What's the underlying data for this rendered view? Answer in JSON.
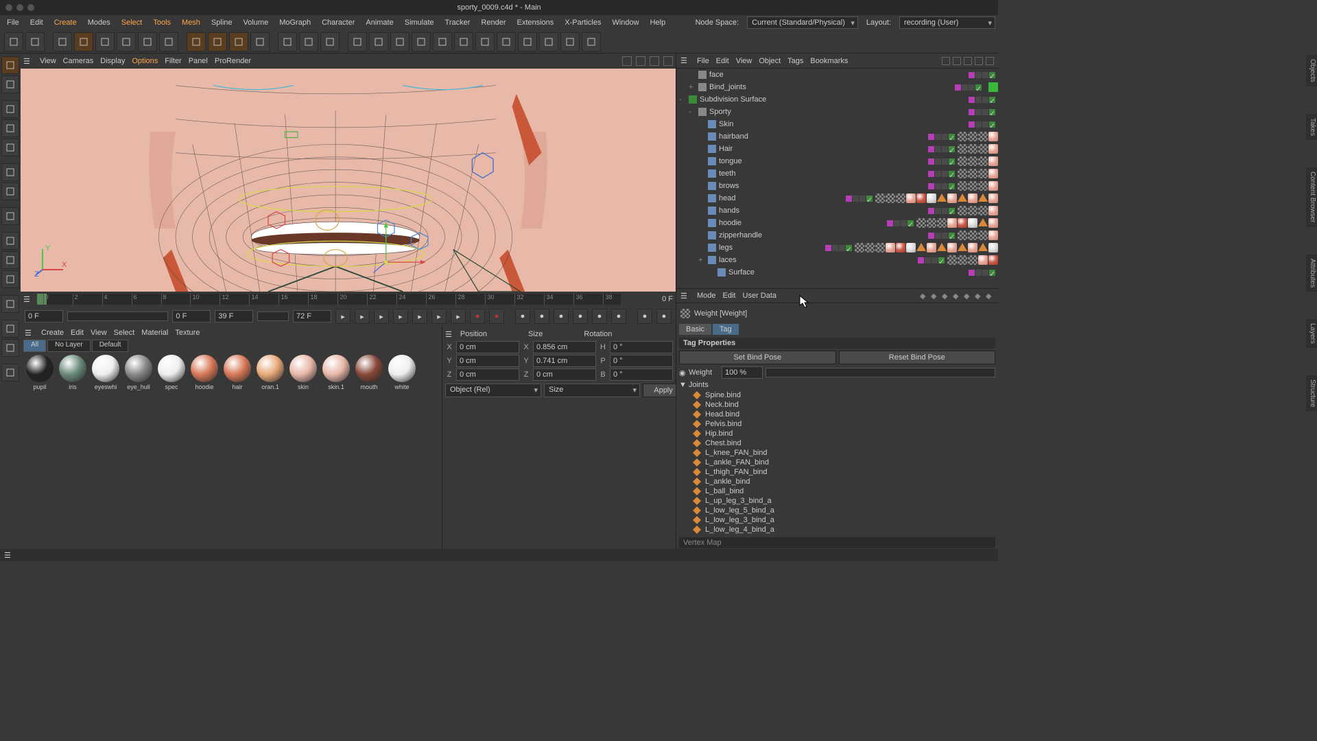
{
  "title": "sporty_0009.c4d * - Main",
  "menubar": [
    "File",
    "Edit",
    "Create",
    "Modes",
    "Select",
    "Tools",
    "Mesh",
    "Spline",
    "Volume",
    "MoGraph",
    "Character",
    "Animate",
    "Simulate",
    "Tracker",
    "Render",
    "Extensions",
    "X-Particles",
    "Window",
    "Help"
  ],
  "menubar_hl": [
    "Create",
    "Select",
    "Tools",
    "Mesh"
  ],
  "nodespace_lbl": "Node Space:",
  "nodespace_val": "Current (Standard/Physical)",
  "layout_lbl": "Layout:",
  "layout_val": "recording (User)",
  "vp_menu": [
    "View",
    "Cameras",
    "Display",
    "Options",
    "Filter",
    "Panel",
    "ProRender"
  ],
  "vp_menu_hl": [
    "Options"
  ],
  "timeline": {
    "ticks": [
      0,
      2,
      4,
      6,
      8,
      10,
      12,
      14,
      16,
      18,
      20,
      22,
      24,
      26,
      28,
      30,
      32,
      34,
      36,
      38
    ],
    "end": "0 F",
    "f0": "0 F",
    "f1": "0 F",
    "f2": "39 F",
    "f3": "72 F"
  },
  "mat_menu": [
    "Create",
    "Edit",
    "View",
    "Select",
    "Material",
    "Texture"
  ],
  "mat_tabs": [
    "All",
    "No Layer",
    "Default"
  ],
  "materials": [
    {
      "n": "pupil",
      "c": "#222"
    },
    {
      "n": "iris",
      "c": "#6a8a7a"
    },
    {
      "n": "eyeswhi",
      "c": "#eee"
    },
    {
      "n": "eye_hull",
      "c": "#888"
    },
    {
      "n": "spec",
      "c": "#eee"
    },
    {
      "n": "hoodie",
      "c": "#d87858"
    },
    {
      "n": "hair",
      "c": "#d87858"
    },
    {
      "n": "oran.1",
      "c": "#e8a878"
    },
    {
      "n": "skin",
      "c": "#e8b8a8"
    },
    {
      "n": "skin.1",
      "c": "#e8b8a8"
    },
    {
      "n": "mouth",
      "c": "#884838"
    },
    {
      "n": "white",
      "c": "#eee"
    }
  ],
  "coord": {
    "pos": "Position",
    "size": "Size",
    "rot": "Rotation",
    "px": "0 cm",
    "py": "0 cm",
    "pz": "0 cm",
    "sx": "0.856 cm",
    "sy": "0.741 cm",
    "sz": "0 cm",
    "rh": "0 °",
    "rp": "0 °",
    "rb": "0 °",
    "mode": "Object (Rel)",
    "smode": "Size",
    "apply": "Apply"
  },
  "om_menu": [
    "File",
    "Edit",
    "View",
    "Object",
    "Tags",
    "Bookmarks"
  ],
  "om_tree": [
    {
      "d": 1,
      "exp": "",
      "n": "face",
      "ico": "#888",
      "tags": 0
    },
    {
      "d": 1,
      "exp": "+",
      "n": "Bind_joints",
      "ico": "#888",
      "extra": "green"
    },
    {
      "d": 0,
      "exp": "-",
      "n": "Subdivision Surface",
      "ico": "#3a8a3a"
    },
    {
      "d": 1,
      "exp": "-",
      "n": "Sporty",
      "ico": "#888"
    },
    {
      "d": 2,
      "exp": "",
      "n": "Skin",
      "ico": "#6a8ab8"
    },
    {
      "d": 2,
      "exp": "",
      "n": "hairband",
      "ico": "#6a8ab8",
      "tags": 4
    },
    {
      "d": 2,
      "exp": "",
      "n": "Hair",
      "ico": "#6a8ab8",
      "tags": 4
    },
    {
      "d": 2,
      "exp": "",
      "n": "tongue",
      "ico": "#6a8ab8",
      "tags": 4
    },
    {
      "d": 2,
      "exp": "",
      "n": "teeth",
      "ico": "#6a8ab8",
      "tags": 4
    },
    {
      "d": 2,
      "exp": "",
      "n": "brows",
      "ico": "#6a8ab8",
      "tags": 4
    },
    {
      "d": 2,
      "exp": "",
      "n": "head",
      "ico": "#6a8ab8",
      "tags": 12
    },
    {
      "d": 2,
      "exp": "",
      "n": "hands",
      "ico": "#6a8ab8",
      "tags": 4
    },
    {
      "d": 2,
      "exp": "",
      "n": "hoodie",
      "ico": "#6a8ab8",
      "tags": 8
    },
    {
      "d": 2,
      "exp": "",
      "n": "zipperhandle",
      "ico": "#6a8ab8",
      "tags": 4
    },
    {
      "d": 2,
      "exp": "",
      "n": "legs",
      "ico": "#6a8ab8",
      "tags": 14
    },
    {
      "d": 2,
      "exp": "+",
      "n": "laces",
      "ico": "#6a8ab8",
      "tags": 5
    },
    {
      "d": 3,
      "exp": "",
      "n": "Surface",
      "ico": "#6a8ab8"
    }
  ],
  "attr_menu": [
    "Mode",
    "Edit",
    "User Data"
  ],
  "attr_title": "Weight [Weight]",
  "attr_tabs": [
    "Basic",
    "Tag"
  ],
  "attr_section": "Tag Properties",
  "attr_btn1": "Set Bind Pose",
  "attr_btn2": "Reset Bind Pose",
  "attr_weight_lbl": "Weight",
  "attr_weight_val": "100 %",
  "attr_joints_lbl": "Joints",
  "joints": [
    "Spine.bind",
    "Neck.bind",
    "Head.bind",
    "Pelvis.bind",
    "Hip.bind",
    "Chest.bind",
    "L_knee_FAN_bind",
    "L_ankle_FAN_bind",
    "L_thigh_FAN_bind",
    "L_ankle_bind",
    "L_ball_bind",
    "L_up_leg_3_bind_a",
    "L_low_leg_5_bind_a",
    "L_low_leg_3_bind_a",
    "L_low_leg_4_bind_a"
  ],
  "vertex_map": "Vertex Map",
  "side_tabs": [
    "Objects",
    "Takes",
    "Content Browser",
    "Attributes",
    "Layers",
    "Structure"
  ]
}
